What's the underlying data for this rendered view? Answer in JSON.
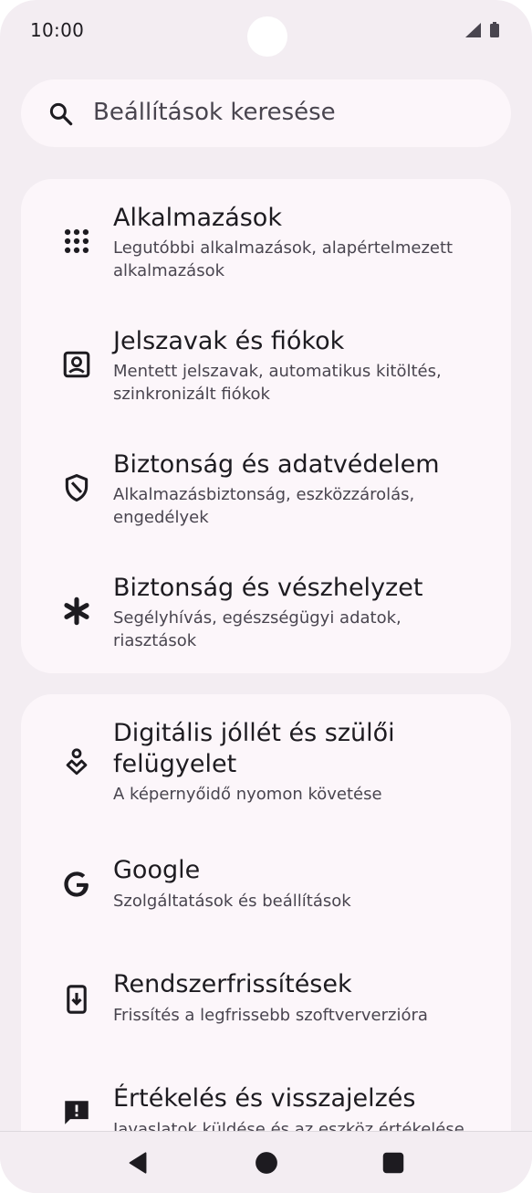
{
  "status_bar": {
    "time": "10:00",
    "icons": [
      "signal-icon",
      "battery-icon"
    ]
  },
  "search": {
    "placeholder": "Beállítások keresése",
    "icon": "search-icon"
  },
  "groups": [
    {
      "items": [
        {
          "icon": "apps-grid-icon",
          "title": "Alkalmazások",
          "subtitle": "Legutóbbi alkalmazások, alapértelmezett alkalmazások"
        },
        {
          "icon": "account-box-icon",
          "title": "Jelszavak és fiókok",
          "subtitle": "Mentett jelszavak, automatikus kitöltés, szinkronizált fiókok"
        },
        {
          "icon": "shield-icon",
          "title": "Biztonság és adatvédelem",
          "subtitle": "Alkalmazásbiztonság, eszközzárolás, engedélyek"
        },
        {
          "icon": "asterisk-icon",
          "title": "Biztonság és vészhelyzet",
          "subtitle": "Segélyhívás, egészségügyi adatok, riasztások"
        }
      ]
    },
    {
      "items": [
        {
          "icon": "wellbeing-icon",
          "title": "Digitális jóllét és szülői felügyelet",
          "subtitle": "A képernyőidő nyomon követése"
        },
        {
          "icon": "google-icon",
          "title": "Google",
          "subtitle": "Szolgáltatások és beállítások"
        },
        {
          "icon": "system-update-icon",
          "title": "Rendszerfrissítések",
          "subtitle": "Frissítés a legfrissebb szoftververzióra"
        },
        {
          "icon": "feedback-icon",
          "title": "Értékelés és visszajelzés",
          "subtitle": "Javaslatok küldése és az eszköz értékelése"
        }
      ]
    }
  ],
  "nav": [
    "back-icon",
    "home-icon",
    "recents-icon"
  ],
  "colors": {
    "background": "#f3edf2",
    "card": "#fcf6fa",
    "text_primary": "#1d1b20",
    "text_secondary": "#49454f"
  }
}
